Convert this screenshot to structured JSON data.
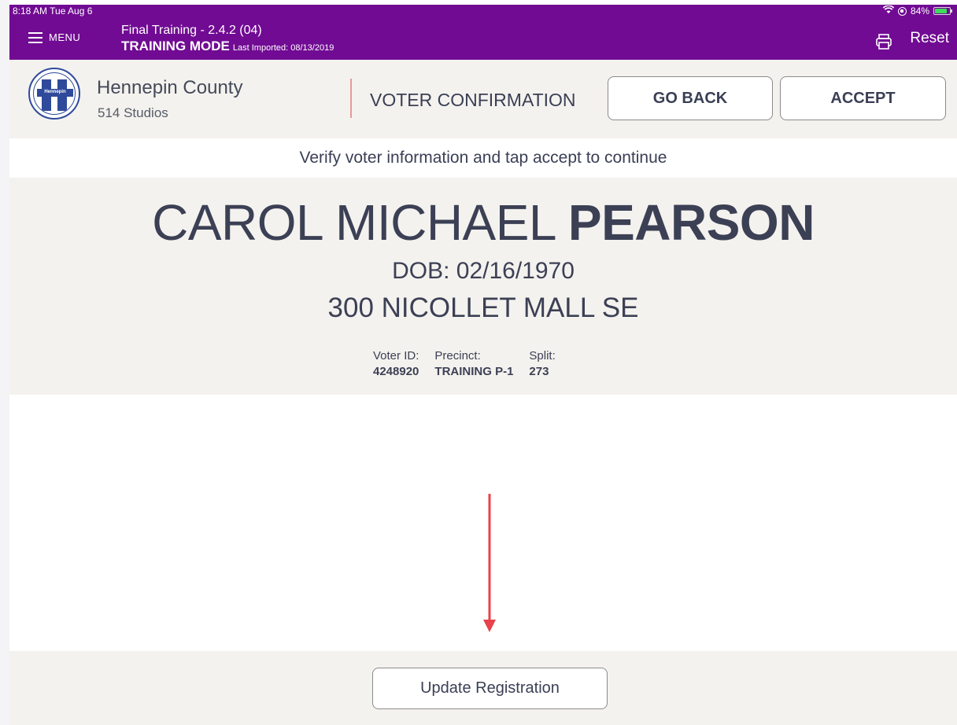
{
  "status_bar": {
    "time": "8:18 AM  Tue Aug 6",
    "battery": "84%",
    "battery_fill": 0.84
  },
  "topbar": {
    "menu_label": "MENU",
    "title_line1": "Final Training - 2.4.2 (04)",
    "mode": "TRAINING MODE",
    "last_imported": "Last Imported: 08/13/2019",
    "reset_label": "Reset",
    "color": "#710b93"
  },
  "header": {
    "logo_text": "Hennepin",
    "org_name": "Hennepin County",
    "org_sub": "514 Studios",
    "screen_title": "VOTER CONFIRMATION",
    "go_back_label": "GO BACK",
    "accept_label": "ACCEPT"
  },
  "instruction": "Verify voter information and tap accept to continue",
  "voter": {
    "first_middle": "CAROL MICHAEL",
    "last": "PEARSON",
    "dob": "DOB: 02/16/1970",
    "address": "300 NICOLLET MALL SE",
    "voter_id_label": "Voter ID:",
    "voter_id": "4248920",
    "precinct_label": "Precinct:",
    "precinct": "TRAINING P-1",
    "split_label": "Split:",
    "split": "273"
  },
  "annotation": {
    "arrow_color": "#e8424a"
  },
  "footer": {
    "update_label": "Update Registration"
  }
}
